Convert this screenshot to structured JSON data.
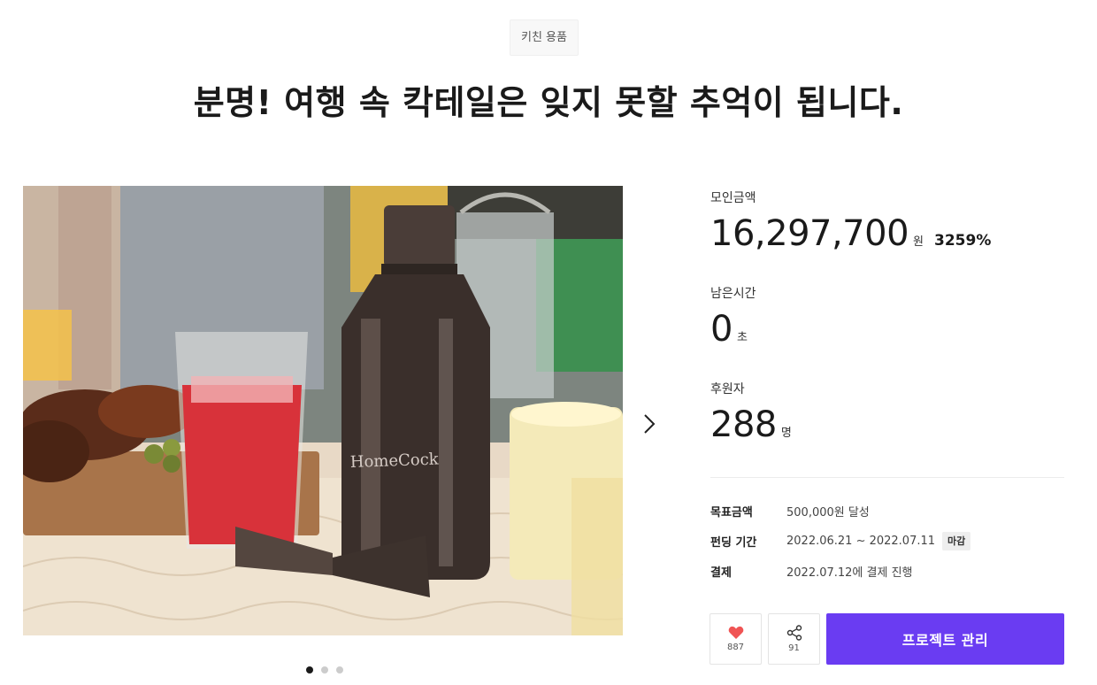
{
  "category": "키친 용품",
  "title": "분명! 여행 속 칵테일은 잊지 못할 추억이 됩니다.",
  "hero": {
    "brand_engraving": "HomeCock",
    "slide_count": 3,
    "active_slide": 1
  },
  "stats": {
    "raised": {
      "label": "모인금액",
      "value": "16,297,700",
      "unit": "원",
      "percent": "3259%"
    },
    "remaining": {
      "label": "남은시간",
      "value": "0",
      "unit": "초"
    },
    "backers": {
      "label": "후원자",
      "value": "288",
      "unit": "명"
    }
  },
  "info": {
    "goal": {
      "key": "목표금액",
      "value": "500,000원 달성"
    },
    "period": {
      "key": "펀딩 기간",
      "value": "2022.06.21 ~ 2022.07.11",
      "badge": "마감"
    },
    "payment": {
      "key": "결제",
      "value": "2022.07.12에 결제 진행"
    }
  },
  "actions": {
    "like_count": "887",
    "share_count": "91",
    "manage_label": "프로젝트 관리"
  },
  "colors": {
    "accent": "#6a3cf2",
    "heart": "#f05454"
  },
  "icons": {
    "like": "heart-icon",
    "share": "share-icon",
    "next": "chevron-right-icon"
  }
}
